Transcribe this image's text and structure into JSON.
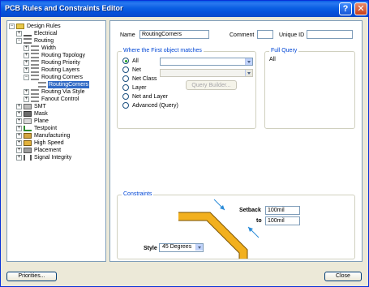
{
  "window": {
    "title": "PCB Rules and Constraints Editor",
    "help_glyph": "?",
    "close_glyph": "✕"
  },
  "tree": {
    "items": [
      {
        "label": "Design Rules",
        "icon": "rules-folder-icon",
        "expander": "−"
      },
      {
        "label": "Electrical",
        "icon": "electrical-icon",
        "expander": "+"
      },
      {
        "label": "Routing",
        "icon": "routing-icon",
        "expander": "−"
      },
      {
        "label": "Width",
        "icon": "routing-rule-icon",
        "expander": "+"
      },
      {
        "label": "Routing Topology",
        "icon": "routing-rule-icon",
        "expander": "+"
      },
      {
        "label": "Routing Priority",
        "icon": "routing-rule-icon",
        "expander": "+"
      },
      {
        "label": "Routing Layers",
        "icon": "routing-rule-icon",
        "expander": "+"
      },
      {
        "label": "Routing Corners",
        "icon": "routing-rule-icon",
        "expander": "−"
      },
      {
        "label": "RoutingCorners",
        "icon": "routing-rule-icon",
        "expander": ""
      },
      {
        "label": "Routing Via Style",
        "icon": "routing-rule-icon",
        "expander": "+"
      },
      {
        "label": "Fanout Control",
        "icon": "routing-rule-icon",
        "expander": "+"
      },
      {
        "label": "SMT",
        "icon": "smt-icon",
        "expander": "+"
      },
      {
        "label": "Mask",
        "icon": "mask-icon",
        "expander": "+"
      },
      {
        "label": "Plane",
        "icon": "plane-icon",
        "expander": "+"
      },
      {
        "label": "Testpoint",
        "icon": "testpoint-icon",
        "expander": "+"
      },
      {
        "label": "Manufacturing",
        "icon": "manufacturing-icon",
        "expander": "+"
      },
      {
        "label": "High Speed",
        "icon": "high-speed-icon",
        "expander": "+"
      },
      {
        "label": "Placement",
        "icon": "placement-icon",
        "expander": "+"
      },
      {
        "label": "Signal Integrity",
        "icon": "signal-integrity-icon",
        "expander": "+"
      }
    ]
  },
  "rule": {
    "name_label": "Name",
    "name_value": "RoutingCorners",
    "comment_label": "Comment",
    "comment_value": "",
    "uid_label": "Unique ID",
    "uid_value": ""
  },
  "match": {
    "title": "Where the First object matches",
    "options": [
      "All",
      "Net",
      "Net Class",
      "Layer",
      "Net and Layer",
      "Advanced (Query)"
    ],
    "selected": "All",
    "query_builder_label": "Query Builder..."
  },
  "full_query": {
    "title": "Full Query",
    "value": "All"
  },
  "constraints": {
    "title": "Constraints",
    "setback_label": "Setback",
    "setback_value": "100mil",
    "to_label": "to",
    "to_value": "100mil",
    "style_label": "Style",
    "style_value": "45 Degrees",
    "trace_color": "#f2b01e"
  },
  "footer": {
    "priorities_label": "Priorities...",
    "close_label": "Close"
  }
}
